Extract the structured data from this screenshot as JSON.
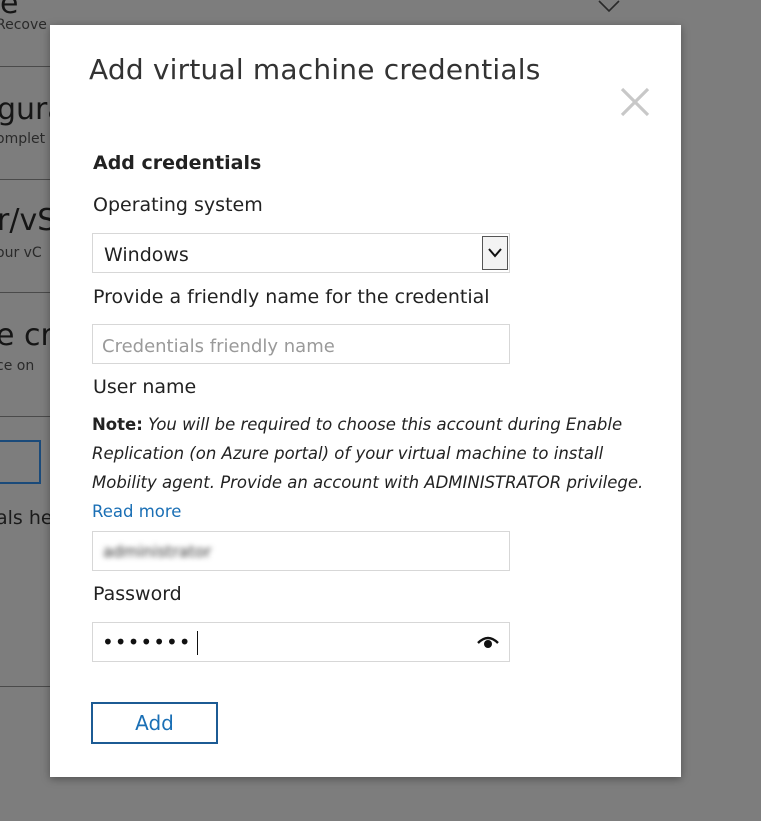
{
  "background": {
    "fragments": [
      "e",
      "Recove",
      "gura",
      "omplet",
      "r/vS",
      "our vC",
      "e cr",
      "ce on",
      "als he"
    ]
  },
  "modal": {
    "title": "Add virtual machine credentials",
    "close_icon": "close-icon",
    "section_heading": "Add credentials",
    "os_label": "Operating system",
    "os_value": "Windows",
    "friendly_name_label": "Provide a friendly name for the credential",
    "friendly_name_placeholder": "Credentials friendly name",
    "friendly_name_value": "",
    "username_label": "User name",
    "note_label": "Note:",
    "note_text": " You will be required to choose this account during Enable Replication (on Azure portal) of your virtual machine to install Mobility agent. Provide an account with ADMINISTRATOR privilege. ",
    "read_more": "Read more",
    "username_value": "administrator",
    "password_label": "Password",
    "password_value": "•••••••",
    "show_password_icon": "eye-icon",
    "add_button": "Add"
  },
  "colors": {
    "overlay": "#7d7d7d",
    "modal_bg": "#ffffff",
    "link": "#1a6fb5",
    "button_border": "#1c5b94"
  }
}
